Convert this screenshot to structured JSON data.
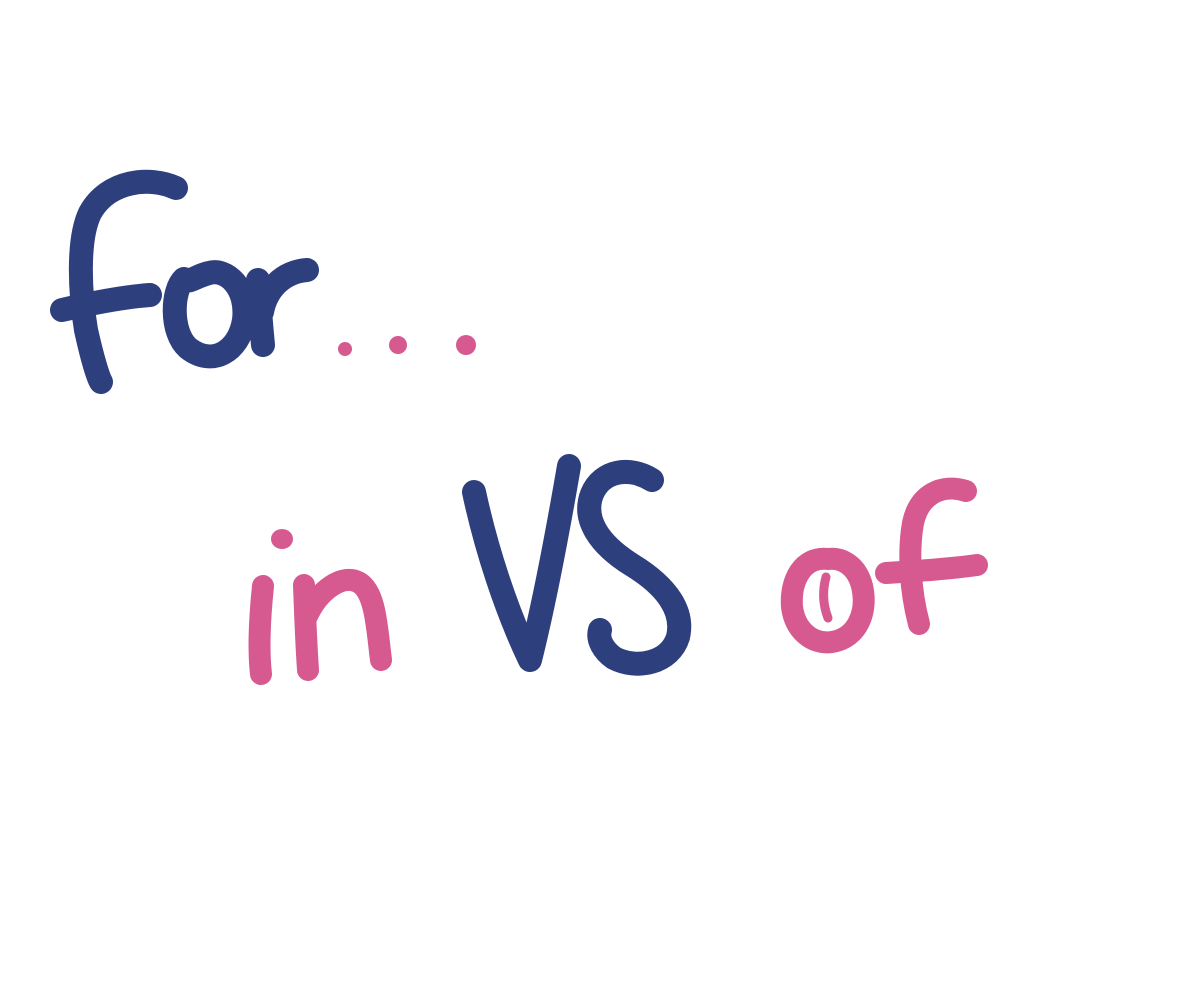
{
  "words": {
    "top": "for",
    "ellipsis": "...",
    "left": "in",
    "middle": "VS",
    "right": "of"
  },
  "colors": {
    "background": "#ffffff",
    "navy": "#2e3f7d",
    "pink": "#d65a90"
  }
}
